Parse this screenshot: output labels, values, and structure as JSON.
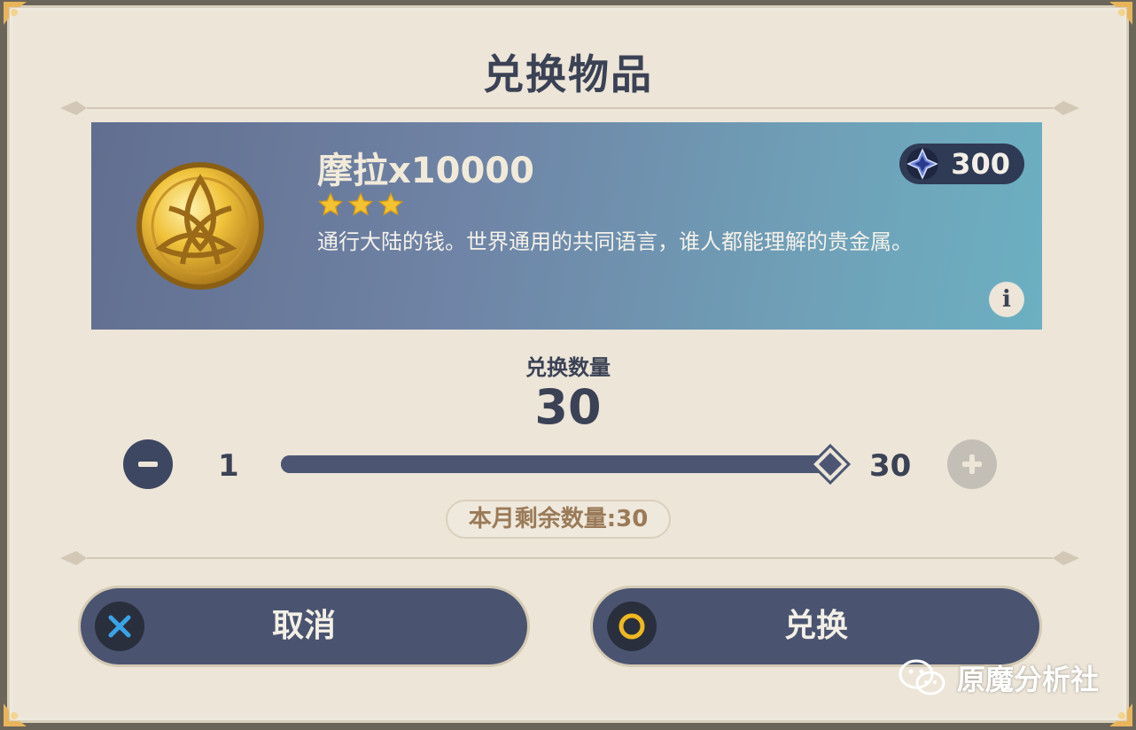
{
  "dialog": {
    "title": "兑换物品"
  },
  "item": {
    "name": "摩拉x10000",
    "rarity_stars": 3,
    "description": "通行大陆的钱。世界通用的共同语言，谁人都能理解的贵金属。",
    "icon": "mora-coin-icon",
    "cost": {
      "icon": "starglitter-icon",
      "value": "300"
    },
    "info_icon": "info-icon"
  },
  "quantity": {
    "label": "兑换数量",
    "value": "30",
    "min": "1",
    "max": "30",
    "slider_fraction": 1.0,
    "remaining_text": "本月剩余数量:30"
  },
  "buttons": {
    "cancel": {
      "label": "取消",
      "icon": "close-x-icon"
    },
    "confirm": {
      "label": "兑换",
      "icon": "circle-icon"
    }
  },
  "watermark": {
    "text": "原魔分析社",
    "icon": "wechat-icon"
  },
  "colors": {
    "panel_bg": "#ece5d8",
    "text_dark": "#3b4255",
    "button_bg": "#4a5470",
    "star_gold": "#f2c230",
    "cancel_icon_blue": "#3aa3e8",
    "confirm_icon_yellow": "#f0b820"
  }
}
